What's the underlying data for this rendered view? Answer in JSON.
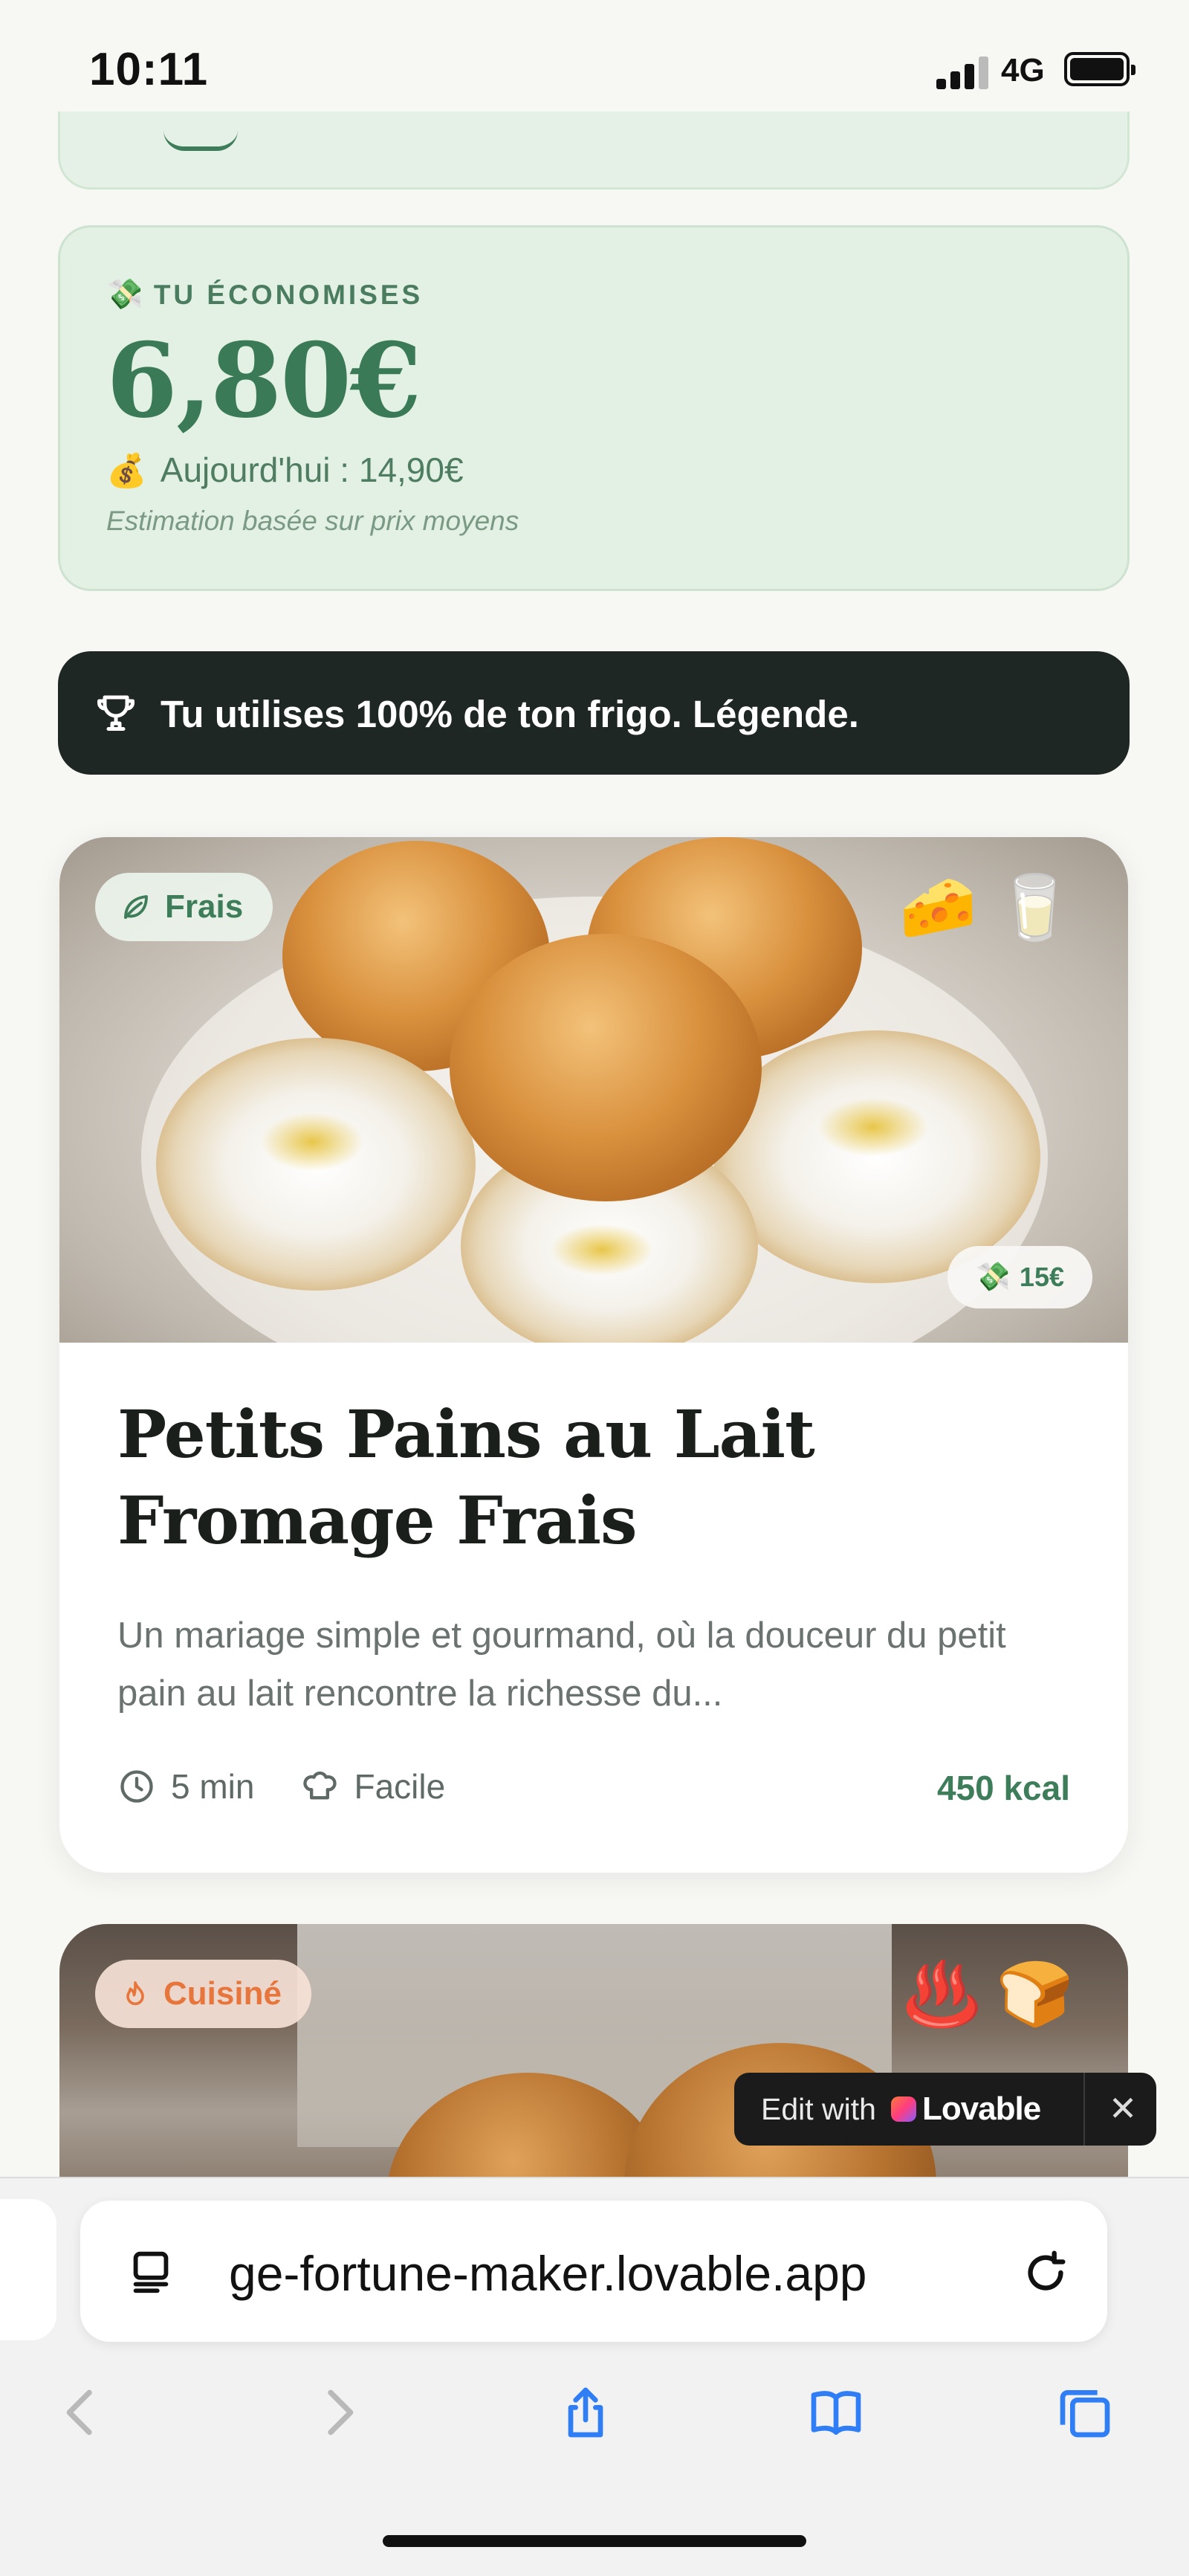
{
  "status_bar": {
    "time": "10:11",
    "network": "4G"
  },
  "savings": {
    "icon": "money-with-wings-icon",
    "label": "TU ÉCONOMISES",
    "amount": "6,80€",
    "today_icon": "money-bag-icon",
    "today": "Aujourd'hui : 14,90€",
    "note": "Estimation basée sur prix moyens"
  },
  "banner": {
    "icon": "trophy-icon",
    "text": "Tu utilises 100% de ton frigo. Légende."
  },
  "recipes": [
    {
      "badge": "Frais",
      "badge_icon": "leaf-icon",
      "ingredient_emojis": [
        "🧀",
        "🥛"
      ],
      "price_icon": "money-with-wings-icon",
      "price": "15€",
      "title": "Petits Pains au Lait Fromage Frais",
      "description": "Un mariage simple et gourmand, où la douceur du petit pain au lait rencontre la richesse du...",
      "time": "5 min",
      "difficulty": "Facile",
      "kcal": "450 kcal"
    },
    {
      "badge": "Cuisiné",
      "badge_icon": "flame-icon",
      "ingredient_emojis": [
        "♨️",
        "🍞"
      ]
    }
  ],
  "lovable": {
    "edit_label": "Edit with",
    "brand": "Lovable",
    "close": "✕"
  },
  "browser": {
    "url": "ge-fortune-maker.lovable.app"
  },
  "colors": {
    "accent_green": "#3d7d59",
    "savings_bg": "#e3f0e4",
    "banner_bg": "#1f2724",
    "cuisine_orange": "#e7763c",
    "ios_blue": "#2f7ef5"
  }
}
